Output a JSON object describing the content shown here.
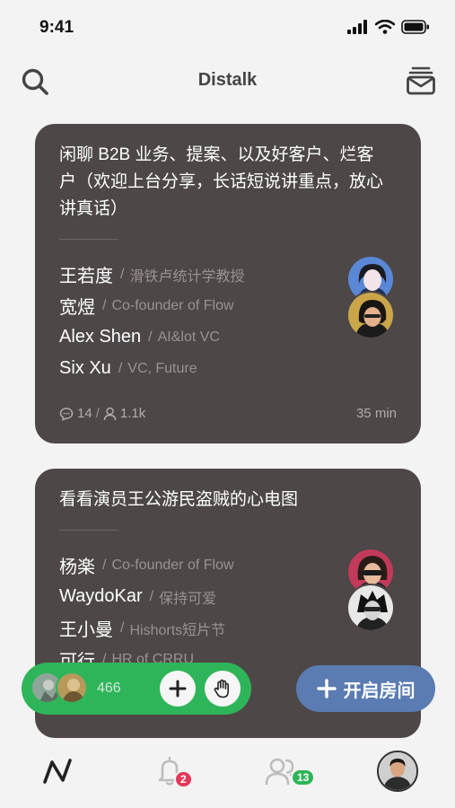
{
  "status": {
    "time": "9:41"
  },
  "header": {
    "title": "Distalk",
    "search_icon": "search-icon",
    "inbox_icon": "inbox-icon"
  },
  "rooms": [
    {
      "title": "闲聊 B2B 业务、提案、以及好客户、烂客户（欢迎上台分享，长话短说讲重点，放心讲真话）",
      "speakers": [
        {
          "name": "王若度",
          "role": "滑铁卢统计学教授"
        },
        {
          "name": "宽煜",
          "role": "Co-founder of Flow"
        },
        {
          "name": "Alex Shen",
          "role": "AI&lot VC"
        },
        {
          "name": "Six Xu",
          "role": "VC, Future"
        }
      ],
      "comments": "14",
      "listeners": "1.1k",
      "duration": "35 min",
      "separator": "/"
    },
    {
      "title": "看看演员王公游民盗贼的心电图",
      "speakers": [
        {
          "name": "杨楽",
          "role": "Co-founder of Flow"
        },
        {
          "name": "WaydoKar",
          "role": "保持可爱"
        },
        {
          "name": "王小曼",
          "role": "Hishorts短片节"
        },
        {
          "name": "可行",
          "role": "HR of CRRU"
        }
      ]
    }
  ],
  "live_bar": {
    "count": "466",
    "add_icon": "plus-icon",
    "hand_icon": "raise-hand-icon"
  },
  "open_room": {
    "label": "开启房间",
    "icon": "plus-icon"
  },
  "tabbar": {
    "home_icon": "activity-icon",
    "notifications_badge": "2",
    "friends_badge": "13"
  },
  "colors": {
    "card": "#4d4747",
    "green": "#2fb559",
    "blue": "#5a7cb2",
    "red": "#e5375a"
  }
}
